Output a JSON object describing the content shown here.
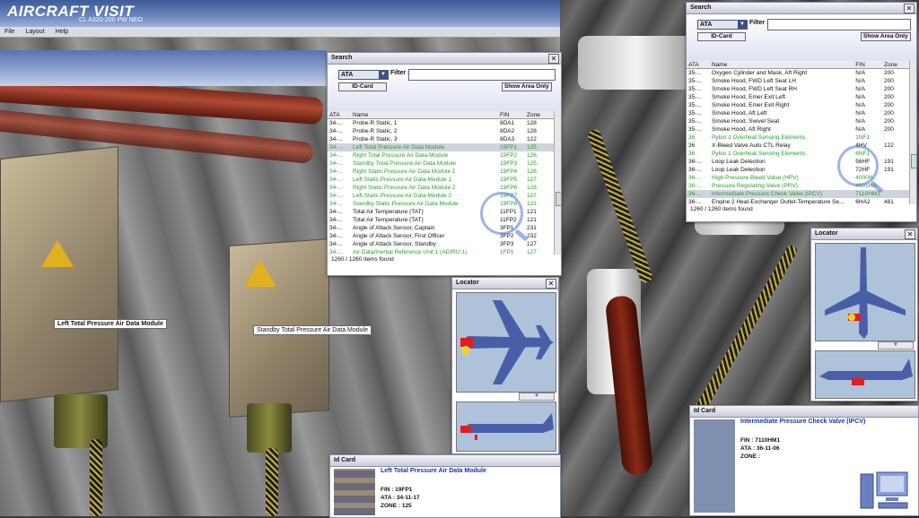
{
  "app": {
    "logo": "AIRCRAFT VISIT",
    "subtitle": "CL A320-200 PW NEO"
  },
  "menu": [
    {
      "label": "File"
    },
    {
      "label": "Layout"
    },
    {
      "label": "Help"
    }
  ],
  "scene_labels": {
    "left_module": "Left Total Pressure Air Data Module",
    "standby_module": "Standby Total Pressure Air Data Module"
  },
  "search_left": {
    "title": "Search",
    "ata_value": "ATA",
    "filter_label": "Filter :",
    "filter_value": "",
    "idcard_button": "ID-Card",
    "show_area_button": "Show Area Only",
    "columns": {
      "ata": "ATA",
      "name": "Name",
      "fin": "FIN",
      "zone": "Zone"
    },
    "rows": [
      {
        "ata": "34-...",
        "name": "Probe-R Static, 1",
        "fin": "8DA1",
        "zone": "128",
        "style": ""
      },
      {
        "ata": "34-...",
        "name": "Probe-R Static, 2",
        "fin": "8DA2",
        "zone": "128",
        "style": ""
      },
      {
        "ata": "34-...",
        "name": "Probe-R Static, 3",
        "fin": "8DA3",
        "zone": "122",
        "style": ""
      },
      {
        "ata": "34-...",
        "name": "Left Total Pressure Air Data Module",
        "fin": "19FP1",
        "zone": "125",
        "style": "green sel"
      },
      {
        "ata": "34-...",
        "name": "Right Total Pressure Air Data Module",
        "fin": "19FP2",
        "zone": "126",
        "style": "green"
      },
      {
        "ata": "34-...",
        "name": "Standby Total Pressure Air Data Module",
        "fin": "19FP3",
        "zone": "125",
        "style": "green"
      },
      {
        "ata": "34-...",
        "name": "Right Static Pressure Air Data Module 1",
        "fin": "19FP4",
        "zone": "128",
        "style": "green"
      },
      {
        "ata": "34-...",
        "name": "Left Static Pressure Air Data Module 1",
        "fin": "19FP5",
        "zone": "127",
        "style": "green"
      },
      {
        "ata": "34-...",
        "name": "Right Static Pressure Air Data Module 2",
        "fin": "19FP6",
        "zone": "128",
        "style": "green"
      },
      {
        "ata": "34-...",
        "name": "Left Static Pressure Air Data Module 2",
        "fin": "19FP7",
        "zone": "127",
        "style": "green"
      },
      {
        "ata": "34-...",
        "name": "Standby Static Pressure Air Data Module",
        "fin": "19FP8",
        "zone": "121",
        "style": "green"
      },
      {
        "ata": "34-...",
        "name": "Total Air Temperature (TAT)",
        "fin": "11FP1",
        "zone": "121",
        "style": ""
      },
      {
        "ata": "34-...",
        "name": "Total Air Temperature (TAT)",
        "fin": "11FP2",
        "zone": "121",
        "style": ""
      },
      {
        "ata": "34-...",
        "name": "Angle of Attack Sensor, Captain",
        "fin": "3FP1",
        "zone": "231",
        "style": ""
      },
      {
        "ata": "34-...",
        "name": "Angle of Attack Sensor, First Officer",
        "fin": "3FP2",
        "zone": "232",
        "style": ""
      },
      {
        "ata": "34-...",
        "name": "Angle of Attack Sensor, Standby",
        "fin": "3FP3",
        "zone": "127",
        "style": ""
      },
      {
        "ata": "34-...",
        "name": "Air Data/Inertial Reference Unit 1 (ADIRU-1)",
        "fin": "1FP1",
        "zone": "127",
        "style": "green"
      }
    ],
    "status": "1260 / 1260 items found"
  },
  "search_right": {
    "title": "Search",
    "ata_value": "ATA",
    "filter_label": "Filter :",
    "filter_value": "",
    "idcard_button": "ID-Card",
    "show_area_button": "Show Area Only",
    "columns": {
      "ata": "ATA",
      "name": "Name",
      "fin": "FIN",
      "zone": "Zone"
    },
    "rows": [
      {
        "ata": "35-...",
        "name": "Oxygen Cylinder and Mask, Aft Right",
        "fin": "N/A",
        "zone": "200",
        "style": ""
      },
      {
        "ata": "35-...",
        "name": "Smoke Hood, FWD Left Seat LH",
        "fin": "N/A",
        "zone": "200",
        "style": ""
      },
      {
        "ata": "35-...",
        "name": "Smoke Hood, FWD Left Seat RH",
        "fin": "N/A",
        "zone": "200",
        "style": ""
      },
      {
        "ata": "35-...",
        "name": "Smoke Hood, Emer Exit Left",
        "fin": "N/A",
        "zone": "200",
        "style": ""
      },
      {
        "ata": "35-...",
        "name": "Smoke Hood, Emer Exit Right",
        "fin": "N/A",
        "zone": "200",
        "style": ""
      },
      {
        "ata": "35-...",
        "name": "Smoke Hood, Aft Left",
        "fin": "N/A",
        "zone": "200",
        "style": ""
      },
      {
        "ata": "35-...",
        "name": "Smoke Hood, Swivel Seat",
        "fin": "N/A",
        "zone": "200",
        "style": ""
      },
      {
        "ata": "35-...",
        "name": "Smoke Hood, Aft Right",
        "fin": "N/A",
        "zone": "200",
        "style": ""
      },
      {
        "ata": "36",
        "name": "Pylon 1 Overheat Sensing Elements",
        "fin": "1NF1",
        "zone": "",
        "style": "green"
      },
      {
        "ata": "36",
        "name": "X-Bleed Valve Auto CTL Relay",
        "fin": "4HV",
        "zone": "122",
        "style": ""
      },
      {
        "ata": "36",
        "name": "Pylon 1 Overheat Sensing Elements",
        "fin": "6NF1",
        "zone": "",
        "style": "green"
      },
      {
        "ata": "36-...",
        "name": "Loop Leak Detection",
        "fin": "56HF",
        "zone": "191",
        "style": ""
      },
      {
        "ata": "36-...",
        "name": "Loop Leak Detection",
        "fin": "72HF",
        "zone": "191",
        "style": ""
      },
      {
        "ata": "36-...",
        "name": "High Pressure Bleed Valve (HPV)",
        "fin": "4000H...",
        "zone": "",
        "style": "green"
      },
      {
        "ata": "36-...",
        "name": "Pressure Regulating Valve (PRV)",
        "fin": "4001HA",
        "zone": "",
        "style": "green"
      },
      {
        "ata": "36-...",
        "name": "Intermediate Pressure Check Valve (IPCV)",
        "fin": "7110HM1",
        "zone": "",
        "style": "green sel"
      },
      {
        "ata": "36-...",
        "name": "Engine 2 Heat-Exchanger Outlet-Temperature Se...",
        "fin": "6HA2",
        "zone": "481",
        "style": ""
      }
    ],
    "status": "1260 / 1260 items found"
  },
  "locator_left": {
    "title": "Locator"
  },
  "locator_right": {
    "title": "Locator"
  },
  "idcard_left": {
    "title": "Id Card",
    "name": "Left Total Pressure Air Data Module",
    "fin": "FIN : 19FP1",
    "ata": "ATA : 34-11-17",
    "zone": "ZONE : 125"
  },
  "idcard_right": {
    "title": "Id Card",
    "name": "Intermediate Pressure Check Valve (IPCV)",
    "fin": "FIN : 7110HM1",
    "ata": "ATA : 36-11-06",
    "zone": "ZONE :"
  },
  "colors": {
    "header": "#3d5b96",
    "green_row": "#2e9a2e",
    "plane": "#4a5ea8",
    "highlight": "#e02020"
  }
}
